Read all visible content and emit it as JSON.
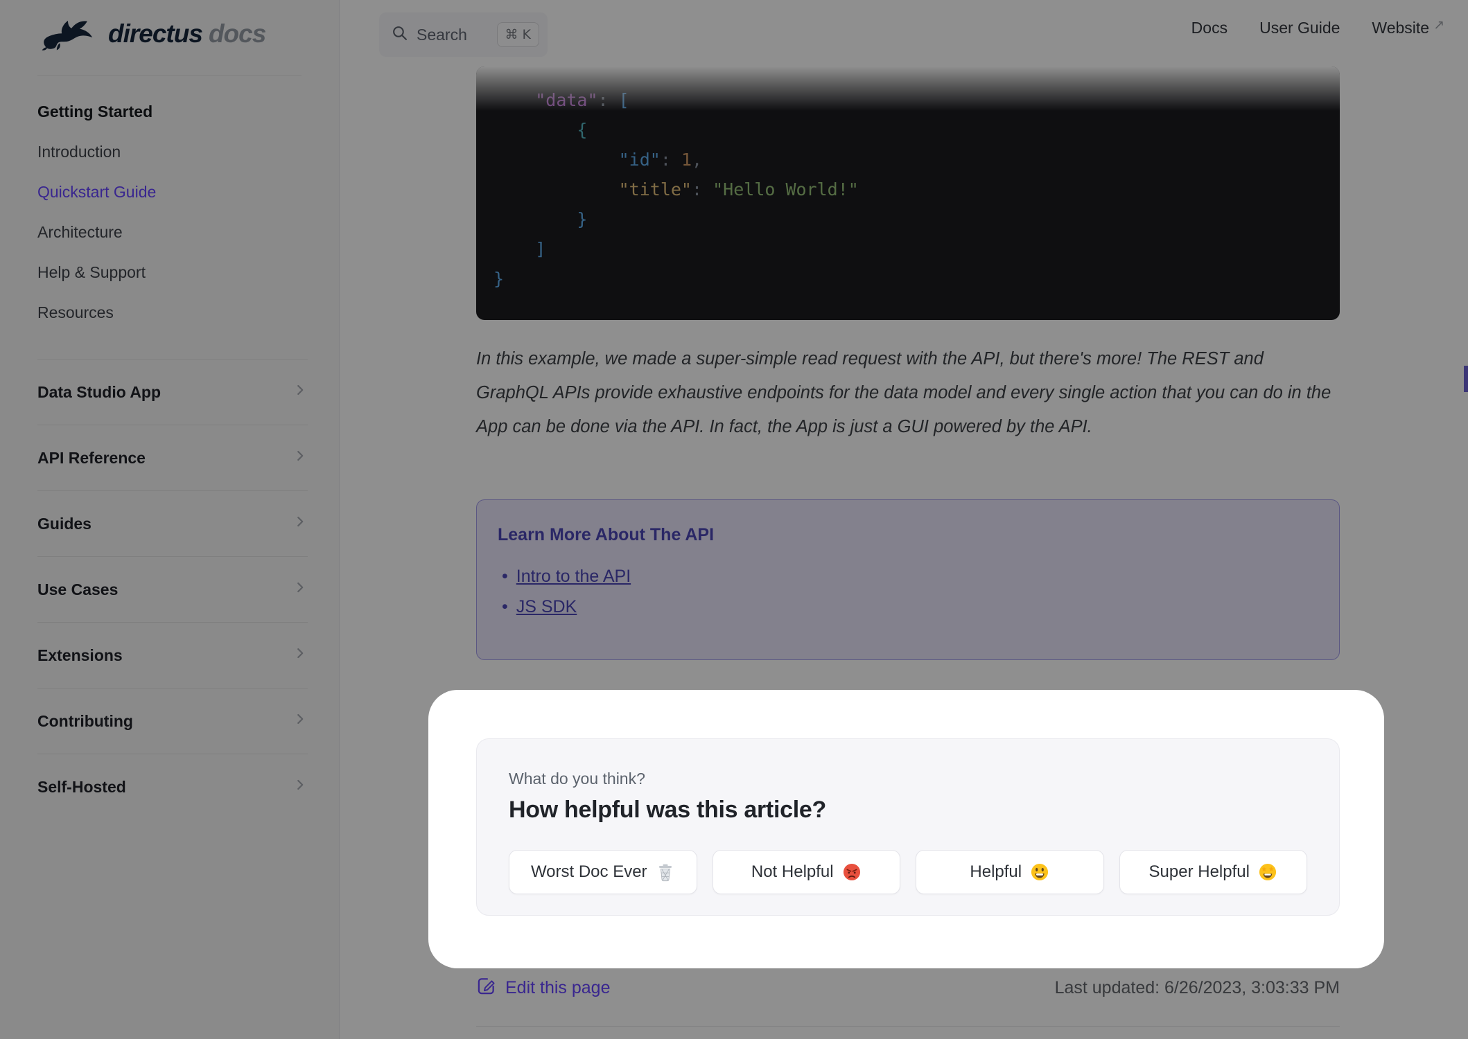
{
  "brand": {
    "name": "directus",
    "suffix": "docs"
  },
  "header": {
    "search": {
      "label": "Search",
      "shortcut": "⌘ K",
      "icon": "search-icon"
    },
    "nav": [
      {
        "label": "Docs",
        "external": false
      },
      {
        "label": "User Guide",
        "external": false
      },
      {
        "label": "Website",
        "external": true
      }
    ]
  },
  "sidebar": {
    "top": {
      "title": "Getting Started",
      "items": [
        {
          "label": "Introduction",
          "active": false
        },
        {
          "label": "Quickstart Guide",
          "active": true
        },
        {
          "label": "Architecture",
          "active": false
        },
        {
          "label": "Help & Support",
          "active": false
        },
        {
          "label": "Resources",
          "active": false
        }
      ]
    },
    "groups": [
      {
        "label": "Data Studio App"
      },
      {
        "label": "API Reference"
      },
      {
        "label": "Guides"
      },
      {
        "label": "Use Cases"
      },
      {
        "label": "Extensions"
      },
      {
        "label": "Contributing"
      },
      {
        "label": "Self-Hosted"
      }
    ]
  },
  "content": {
    "code": {
      "lines": [
        [
          [
            "pun",
            "    "
          ],
          [
            "pur",
            "\"data\""
          ],
          [
            "pun",
            ": "
          ],
          [
            "blu",
            "["
          ]
        ],
        [
          [
            "pun",
            "        "
          ],
          [
            "cyn",
            "{"
          ]
        ],
        [
          [
            "pun",
            "            "
          ],
          [
            "blu",
            "\"id\""
          ],
          [
            "pun",
            ": "
          ],
          [
            "org",
            "1"
          ],
          [
            "pun",
            ","
          ]
        ],
        [
          [
            "pun",
            "            "
          ],
          [
            "yel",
            "\"title\""
          ],
          [
            "pun",
            ": "
          ],
          [
            "grn",
            "\"Hello World!\""
          ]
        ],
        [
          [
            "pun",
            "        "
          ],
          [
            "blu",
            "}"
          ]
        ],
        [
          [
            "pun",
            "    "
          ],
          [
            "blu",
            "]"
          ]
        ],
        [
          [
            "blu",
            "}"
          ]
        ]
      ]
    },
    "paragraph": "In this example, we made a super-simple read request with the API, but there's more! The REST and GraphQL APIs provide exhaustive endpoints for the data model and every single action that you can do in the App can be done via the API. In fact, the App is just a GUI powered by the API.",
    "info_box": {
      "title": "Learn More About The API",
      "links": [
        {
          "label": "Intro to the API"
        },
        {
          "label": "JS SDK"
        }
      ]
    },
    "feedback": {
      "kicker": "What do you think?",
      "title": "How helpful was this article?",
      "buttons": [
        {
          "label": "Worst Doc Ever",
          "emoji": "🗑️",
          "icon": "trash-emoji"
        },
        {
          "label": "Not Helpful",
          "emoji": "😡",
          "icon": "angry-emoji"
        },
        {
          "label": "Helpful",
          "emoji": "😃",
          "icon": "smile-emoji"
        },
        {
          "label": "Super Helpful",
          "emoji": "🤩",
          "icon": "starstruck-emoji"
        }
      ]
    },
    "footer": {
      "edit_label": "Edit this page",
      "last_updated": "Last updated: 6/26/2023, 3:03:33 PM"
    }
  },
  "colors": {
    "accent": "#6644ff",
    "code_bg": "#1b1b1f",
    "info_bg": "#e9e7fb",
    "info_border": "#a29bea",
    "info_text": "#4c46b6",
    "card_bg": "#f6f6f9",
    "sidebar_bg": "#f6f6f7",
    "overlay": "rgba(0,0,0,0.44)"
  }
}
